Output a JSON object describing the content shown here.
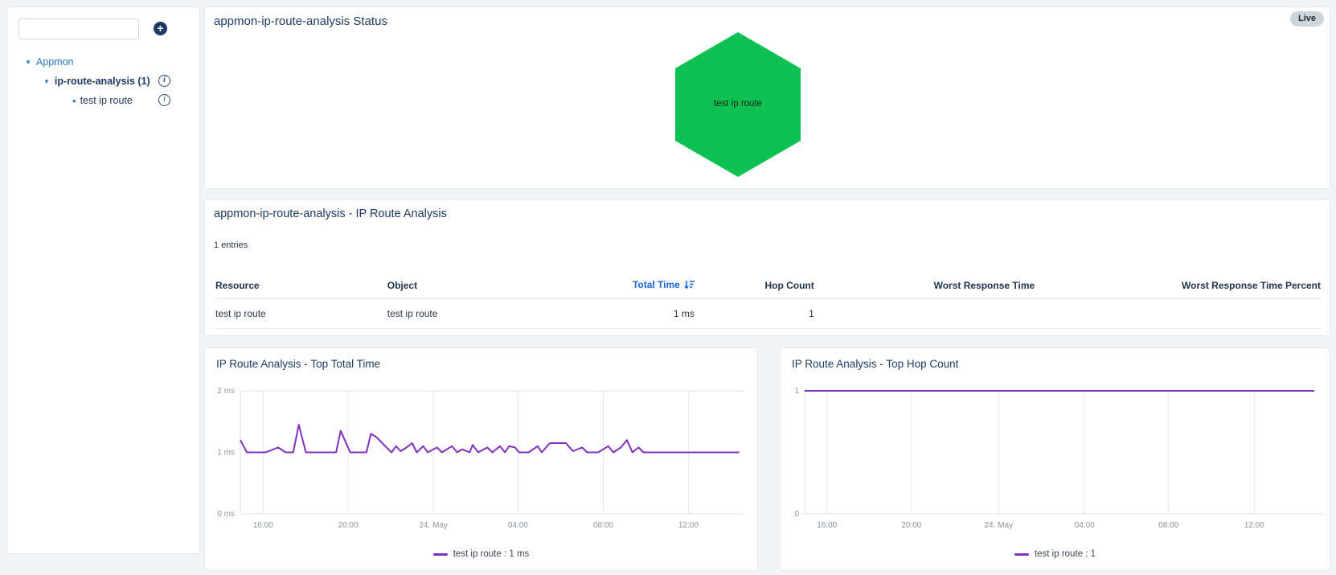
{
  "colors": {
    "accent_blue": "#1668dd",
    "tree_blue": "#2878be",
    "navy": "#1e3a66",
    "series_purple": "#8230c0",
    "status_green": "#0dc153"
  },
  "sidebar": {
    "search": {
      "value": "",
      "placeholder": ""
    },
    "add_button_label": "+",
    "tree": {
      "root": {
        "label": "Appmon"
      },
      "group": {
        "label": "ip-route-analysis (1)"
      },
      "leaf": {
        "label": "test ip route"
      }
    }
  },
  "status_panel": {
    "title": "appmon-ip-route-analysis Status",
    "live_badge": "Live",
    "hexagon": {
      "label": "test ip route",
      "color": "#0dc153"
    }
  },
  "table_panel": {
    "title": "appmon-ip-route-analysis - IP Route Analysis",
    "entries_text": "1 entries",
    "columns": [
      "Resource",
      "Object",
      "Total Time",
      "Hop Count",
      "Worst Response Time",
      "Worst Response Time Percent"
    ],
    "sorted_column": "Total Time",
    "rows": [
      [
        "test ip route",
        "test ip route",
        "1 ms",
        "1",
        "",
        ""
      ]
    ]
  },
  "chart_data": [
    {
      "type": "line",
      "title": "IP Route Analysis - Top Total Time",
      "ylim": [
        0,
        2
      ],
      "y_ticks": [
        {
          "label": "2 ms",
          "value": 2
        },
        {
          "label": "1 ms",
          "value": 1
        },
        {
          "label": "0 ms",
          "value": 0
        }
      ],
      "x_ticks": [
        {
          "label": "16:00",
          "frac": 0.045
        },
        {
          "label": "20:00",
          "frac": 0.214
        },
        {
          "label": "24. May",
          "frac": 0.383
        },
        {
          "label": "04:00",
          "frac": 0.551
        },
        {
          "label": "08:00",
          "frac": 0.72
        },
        {
          "label": "12:00",
          "frac": 0.889
        }
      ],
      "top_border": true,
      "series": [
        {
          "name": "test ip route",
          "color": "#8230c0",
          "points": [
            [
              0,
              1.2
            ],
            [
              0.013,
              1.0
            ],
            [
              0.05,
              1.0
            ],
            [
              0.075,
              1.08
            ],
            [
              0.09,
              1.0
            ],
            [
              0.105,
              1.0
            ],
            [
              0.116,
              1.45
            ],
            [
              0.13,
              1.0
            ],
            [
              0.19,
              1.0
            ],
            [
              0.199,
              1.35
            ],
            [
              0.206,
              1.22
            ],
            [
              0.218,
              1.0
            ],
            [
              0.25,
              1.0
            ],
            [
              0.259,
              1.3
            ],
            [
              0.27,
              1.25
            ],
            [
              0.29,
              1.08
            ],
            [
              0.3,
              1.0
            ],
            [
              0.309,
              1.1
            ],
            [
              0.318,
              1.02
            ],
            [
              0.328,
              1.07
            ],
            [
              0.341,
              1.15
            ],
            [
              0.35,
              1.0
            ],
            [
              0.363,
              1.1
            ],
            [
              0.372,
              1.0
            ],
            [
              0.39,
              1.08
            ],
            [
              0.4,
              1.0
            ],
            [
              0.42,
              1.1
            ],
            [
              0.43,
              1.0
            ],
            [
              0.44,
              1.05
            ],
            [
              0.455,
              1.0
            ],
            [
              0.461,
              1.12
            ],
            [
              0.472,
              1.0
            ],
            [
              0.49,
              1.08
            ],
            [
              0.5,
              1.0
            ],
            [
              0.515,
              1.1
            ],
            [
              0.525,
              1.0
            ],
            [
              0.533,
              1.1
            ],
            [
              0.545,
              1.08
            ],
            [
              0.553,
              1.0
            ],
            [
              0.572,
              1.0
            ],
            [
              0.59,
              1.1
            ],
            [
              0.598,
              1.0
            ],
            [
              0.614,
              1.15
            ],
            [
              0.646,
              1.15
            ],
            [
              0.66,
              1.02
            ],
            [
              0.678,
              1.08
            ],
            [
              0.688,
              1.0
            ],
            [
              0.71,
              1.0
            ],
            [
              0.73,
              1.1
            ],
            [
              0.74,
              1.0
            ],
            [
              0.755,
              1.08
            ],
            [
              0.767,
              1.2
            ],
            [
              0.778,
              1.0
            ],
            [
              0.79,
              1.08
            ],
            [
              0.8,
              1.0
            ],
            [
              0.99,
              1.0
            ]
          ]
        }
      ],
      "legend": {
        "label": "test ip route",
        "value": " : 1 ms"
      }
    },
    {
      "type": "line",
      "title": "IP Route Analysis - Top Hop Count",
      "ylim": [
        0,
        1
      ],
      "y_ticks": [
        {
          "label": "1",
          "value": 1
        },
        {
          "label": "0",
          "value": 0
        }
      ],
      "x_ticks": [
        {
          "label": "16:00",
          "frac": 0.043
        },
        {
          "label": "20:00",
          "frac": 0.206
        },
        {
          "label": "24. May",
          "frac": 0.374
        },
        {
          "label": "04:00",
          "frac": 0.54
        },
        {
          "label": "08:00",
          "frac": 0.702
        },
        {
          "label": "12:00",
          "frac": 0.867
        }
      ],
      "top_border": false,
      "series": [
        {
          "name": "test ip route",
          "color": "#8230c0",
          "points": [
            [
              0,
              1
            ],
            [
              0.983,
              1
            ]
          ]
        }
      ],
      "legend": {
        "label": "test ip route",
        "value": " : 1"
      }
    }
  ]
}
